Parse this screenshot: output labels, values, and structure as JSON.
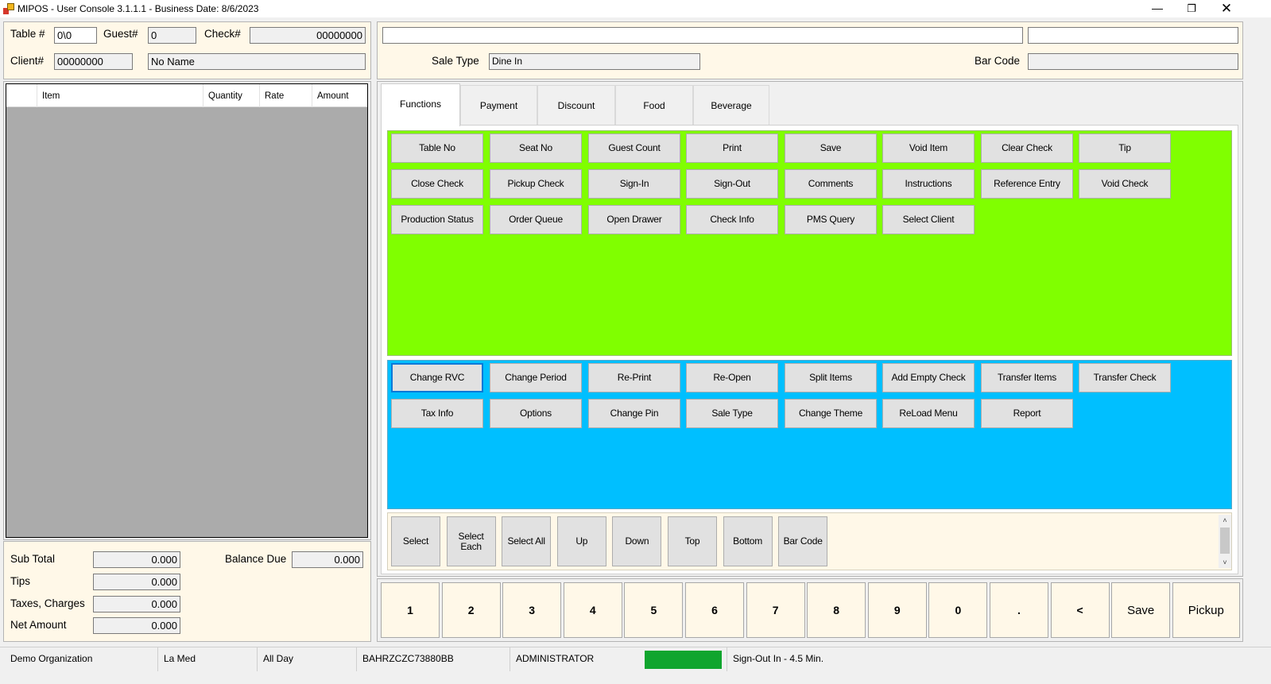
{
  "window": {
    "title": "MIPOS - User Console 3.1.1.1 - Business Date: 8/6/2023",
    "minimize_icon": "minimize-icon",
    "restore_icon": "restore-icon",
    "close_icon": "close-icon"
  },
  "header": {
    "table_label": "Table #",
    "table_value": "0\\0",
    "guest_label": "Guest#",
    "guest_value": "0",
    "check_label": "Check#",
    "check_value": "00000000",
    "client_label": "Client#",
    "client_value": "00000000",
    "client_name": "No Name"
  },
  "grid": {
    "columns": [
      "Item",
      "Quantity",
      "Rate",
      "Amount"
    ]
  },
  "totals": {
    "sub_total_label": "Sub Total",
    "sub_total": "0.000",
    "tips_label": "Tips",
    "tips": "0.000",
    "taxes_label": "Taxes, Charges",
    "taxes": "0.000",
    "net_label": "Net Amount",
    "net": "0.000",
    "balance_label": "Balance Due",
    "balance": "0.000"
  },
  "top_right": {
    "input1": "",
    "input2": "",
    "sale_type_label": "Sale Type",
    "sale_type_value": "Dine In",
    "bar_code_label": "Bar Code",
    "bar_code_value": ""
  },
  "tabs": [
    "Functions",
    "Payment",
    "Discount",
    "Food",
    "Beverage"
  ],
  "functions": {
    "green_rows": [
      [
        "Table No",
        "Seat No",
        "Guest Count",
        "Print",
        "Save",
        "Void Item",
        "Clear Check",
        "Tip"
      ],
      [
        "Close Check",
        "Pickup Check",
        "Sign-In",
        "Sign-Out",
        "Comments",
        "Instructions",
        "Reference Entry",
        "Void Check"
      ],
      [
        "Production Status",
        "Order Queue",
        "Open Drawer",
        "Check Info",
        "PMS Query",
        "Select Client"
      ]
    ],
    "blue_rows": [
      [
        "Change RVC",
        "Change Period",
        "Re-Print",
        "Re-Open",
        "Split Items",
        "Add Empty Check",
        "Transfer Items",
        "Transfer Check"
      ],
      [
        "Tax Info",
        "Options",
        "Change  Pin",
        "Sale Type",
        "Change Theme",
        "ReLoad Menu",
        "Report"
      ]
    ],
    "green_color": "#80ff00",
    "blue_color": "#00bfff"
  },
  "selection": {
    "buttons": [
      "Select",
      "Select\nEach",
      "Select All",
      "Up",
      "Down",
      "Top",
      "Bottom",
      "Bar Code"
    ]
  },
  "keypad": {
    "keys": [
      "1",
      "2",
      "3",
      "4",
      "5",
      "6",
      "7",
      "8",
      "9",
      "0",
      ".",
      "<",
      "Save",
      "Pickup"
    ]
  },
  "status": {
    "organization": "Demo Organization",
    "outlet": "La Med",
    "period": "All Day",
    "terminal": "BAHRZCZC73880BB",
    "user": "ADMINISTRATOR",
    "indicator_color": "#10a52e",
    "sign_out": "Sign-Out In - 4.5 Min."
  }
}
